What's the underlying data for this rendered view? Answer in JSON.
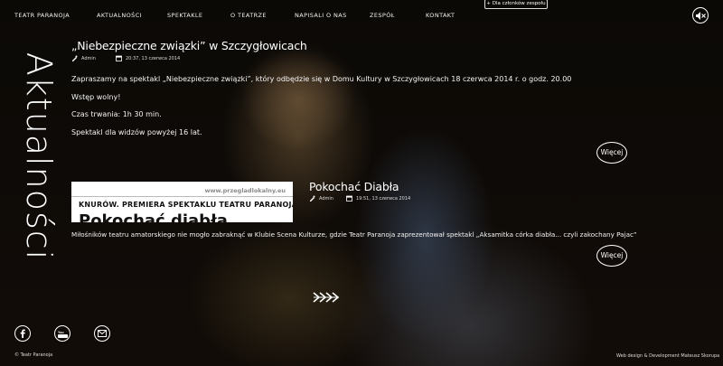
{
  "nav": {
    "items": [
      "TEATR PARANOJA",
      "AKTUALNOŚCI",
      "SPEKTAKLE",
      "O TEATRZE",
      "NAPISALI O NAS",
      "ZESPÓŁ",
      "KONTAKT"
    ],
    "member_link": "+ Dla członków zespołu"
  },
  "page": {
    "section_title": "Aktualności"
  },
  "posts": [
    {
      "title": "„Niebezpieczne związki” w Szczygłowicach",
      "author": "Admin",
      "date": "20:37, 13 czerwca 2014",
      "paragraphs": [
        "Zapraszamy na spektakl „Niebezpieczne związki”, który odbędzie się w Domu Kultury w Szczygłowicach 18 czerwca 2014 r. o godz.  20.00",
        "Wstęp wolny!",
        "Czas trwania: 1h 30 min.",
        "Spektakl dla widzów powyżej 16 lat."
      ],
      "more": "Więcej"
    },
    {
      "title": "Pokochać Diabła",
      "author": "Admin",
      "date": "19:51, 13 czerwca 2014",
      "thumb_site": "www.przegladlokalny.eu",
      "thumb_heading": "KNURÓW. PREMIERA SPEKTAKLU TEATRU PARANOJA",
      "thumb_big": "Pokochać diabła",
      "excerpt": "Miłośników teatru amatorskiego nie mogło zabraknąć w Klubie Scena Kulturze, gdzie Teatr Paranoja zaprezentował spektakl „Aksamitka córka diabła... czyli zakochany Pajac”",
      "more": "Więcej"
    }
  ],
  "footer": {
    "copyright": "© Teatr Paranoja",
    "credits": "Web design & Development Mateusz Skorupa"
  },
  "icons": [
    "sound-mute-icon",
    "user-icon",
    "calendar-icon",
    "double-arrow-right-icon",
    "facebook-icon",
    "youtube-icon",
    "mail-icon"
  ]
}
